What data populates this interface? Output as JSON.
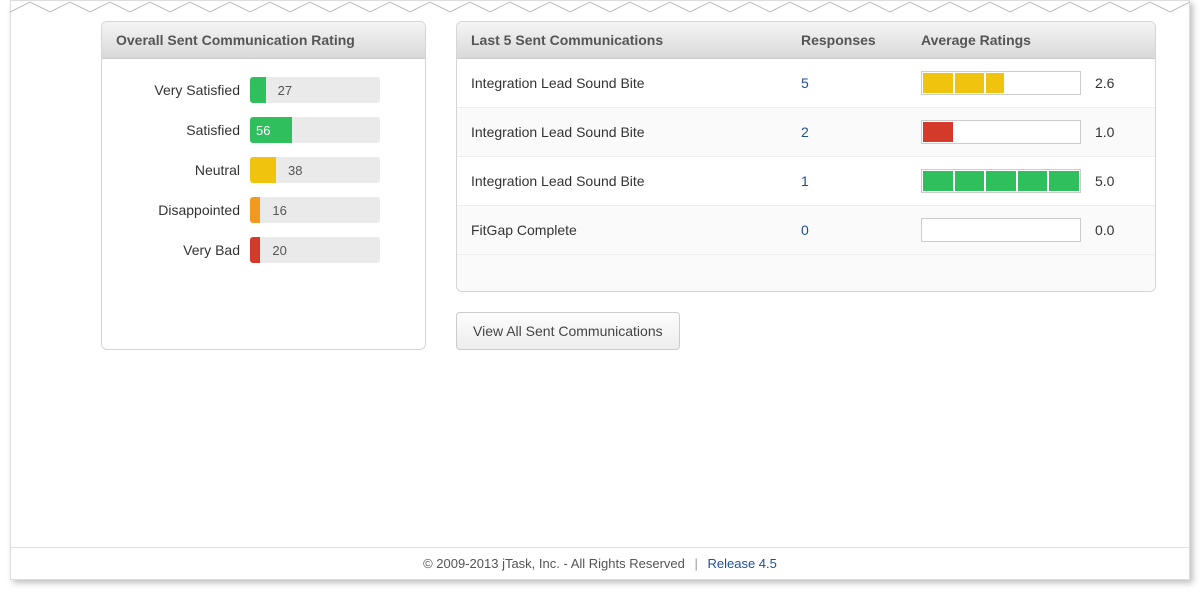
{
  "colors": {
    "green": "#2fbf5d",
    "yellow": "#f0c30f",
    "orange": "#f29a1f",
    "red": "#d43a2a",
    "seg_green": "#2fbf5d",
    "seg_yellow": "#f0c30f",
    "seg_red": "#d43a2a"
  },
  "left_panel": {
    "title": "Overall Sent Communication Rating",
    "rows": [
      {
        "label": "Very Satisfied",
        "value": "27",
        "pct": 12,
        "color": "green",
        "value_inside": false
      },
      {
        "label": "Satisfied",
        "value": "56",
        "pct": 32,
        "color": "green",
        "value_inside": true
      },
      {
        "label": "Neutral",
        "value": "38",
        "pct": 20,
        "color": "yellow",
        "value_inside": false
      },
      {
        "label": "Disappointed",
        "value": "16",
        "pct": 8,
        "color": "orange",
        "value_inside": false
      },
      {
        "label": "Very Bad",
        "value": "20",
        "pct": 8,
        "color": "red",
        "value_inside": false
      }
    ]
  },
  "right_panel": {
    "headers": {
      "name": "Last 5 Sent Communications",
      "responses": "Responses",
      "avg": "Average Ratings"
    },
    "rows": [
      {
        "name": "Integration Lead Sound Bite",
        "responses": "5",
        "rating": "2.6",
        "segs": [
          "yellow",
          "yellow",
          "half-yellow",
          "none",
          "none"
        ]
      },
      {
        "name": "Integration Lead Sound Bite",
        "responses": "2",
        "rating": "1.0",
        "segs": [
          "red",
          "none",
          "none",
          "none",
          "none"
        ]
      },
      {
        "name": "Integration Lead Sound Bite",
        "responses": "1",
        "rating": "5.0",
        "segs": [
          "green",
          "green",
          "green",
          "green",
          "green"
        ]
      },
      {
        "name": "FitGap Complete",
        "responses": "0",
        "rating": "0.0",
        "segs": [
          "none",
          "none",
          "none",
          "none",
          "none"
        ]
      }
    ]
  },
  "button_label": "View All Sent Communications",
  "footer": {
    "copyright": "© 2009-2013 jTask, Inc. - All Rights Reserved",
    "release": "Release 4.5"
  },
  "chart_data": {
    "type": "bar",
    "title": "Overall Sent Communication Rating",
    "categories": [
      "Very Satisfied",
      "Satisfied",
      "Neutral",
      "Disappointed",
      "Very Bad"
    ],
    "values": [
      27,
      56,
      38,
      16,
      20
    ],
    "xlabel": "",
    "ylabel": ""
  }
}
